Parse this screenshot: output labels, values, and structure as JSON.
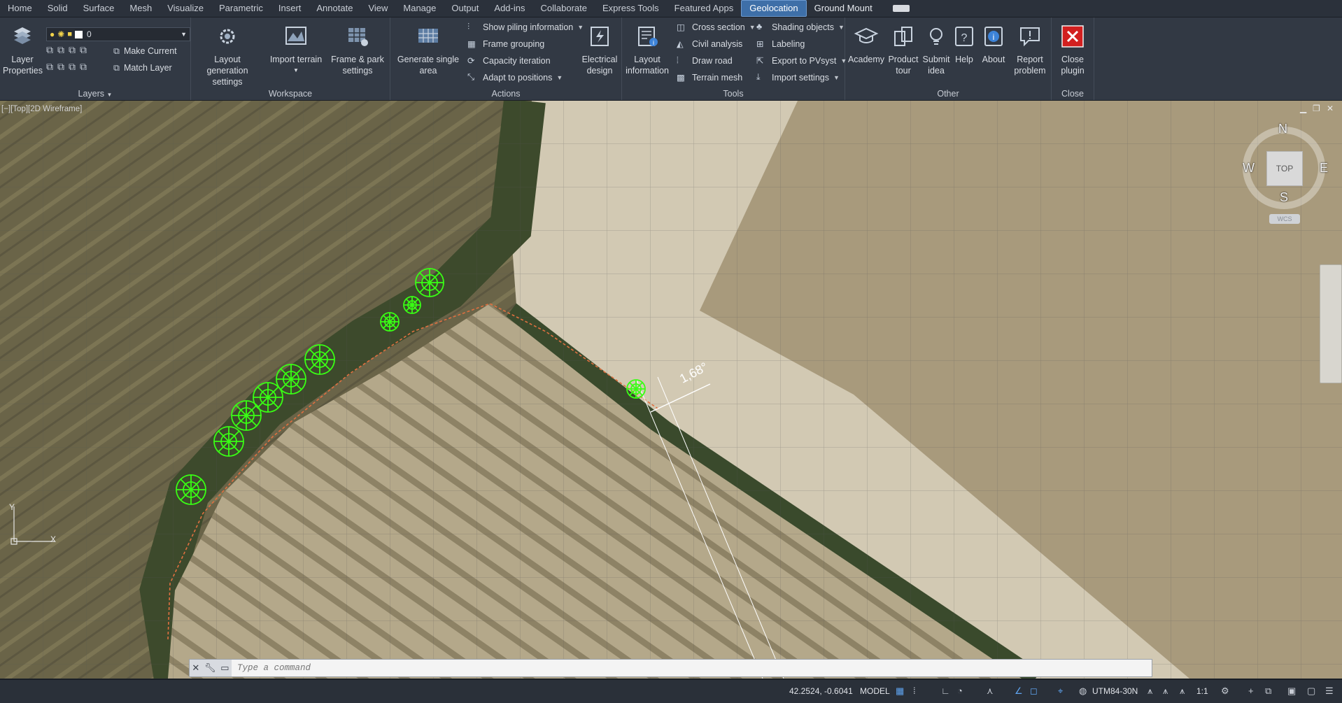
{
  "tabs": [
    {
      "label": "Home"
    },
    {
      "label": "Solid"
    },
    {
      "label": "Surface"
    },
    {
      "label": "Mesh"
    },
    {
      "label": "Visualize"
    },
    {
      "label": "Parametric"
    },
    {
      "label": "Insert"
    },
    {
      "label": "Annotate"
    },
    {
      "label": "View"
    },
    {
      "label": "Manage"
    },
    {
      "label": "Output"
    },
    {
      "label": "Add-ins"
    },
    {
      "label": "Collaborate"
    },
    {
      "label": "Express Tools"
    },
    {
      "label": "Featured Apps"
    },
    {
      "label": "Geolocation"
    },
    {
      "label": "Ground Mount"
    }
  ],
  "active_tab": "Geolocation",
  "ribbon": {
    "layers": {
      "title": "Layers",
      "layer_properties": "Layer\nProperties",
      "layer_value": "0",
      "make_current": "Make Current",
      "match_layer": "Match Layer"
    },
    "workspace": {
      "title": "Workspace",
      "layout_generation": "Layout generation\nsettings",
      "import_terrain": "Import terrain",
      "frame_park": "Frame & park\nsettings"
    },
    "actions": {
      "title": "Actions",
      "generate_single_area": "Generate single\narea",
      "show_piling": "Show piling information",
      "frame_grouping": "Frame grouping",
      "capacity_iteration": "Capacity iteration",
      "adapt_positions": "Adapt to positions",
      "electrical_design": "Electrical\ndesign"
    },
    "tools": {
      "title": "Tools",
      "layout_information": "Layout\ninformation",
      "cross_section": "Cross section",
      "civil_analysis": "Civil analysis",
      "draw_road": "Draw road",
      "terrain_mesh": "Terrain mesh",
      "shading_objects": "Shading objects",
      "labeling": "Labeling",
      "export_pvsyst": "Export to PVsyst",
      "import_settings": "Import settings"
    },
    "other": {
      "title": "Other",
      "academy": "Academy",
      "product_tour": "Product\ntour",
      "submit_idea": "Submit\nidea",
      "help": "Help",
      "about": "About",
      "report_problem": "Report\nproblem"
    },
    "close": {
      "title": "Close",
      "close_plugin": "Close\nplugin"
    }
  },
  "viewport": {
    "label": "[−][Top][2D Wireframe]",
    "angle_label": "1,68°",
    "compass": {
      "n": "N",
      "s": "S",
      "e": "E",
      "w": "W",
      "top": "TOP",
      "wcs": "WCS"
    },
    "axis_x": "X",
    "axis_y": "Y"
  },
  "command_line": {
    "placeholder": "Type a command"
  },
  "status_bar": {
    "coordinates": "42.2524, -0.6041",
    "model": "MODEL",
    "crs": "UTM84-30N",
    "scale": "1:1"
  },
  "colors": {
    "ribbon_bg": "#323944",
    "tabbar_bg": "#2b313b",
    "active_tab": "#3e6fa8",
    "tree_marker": "#39ff14",
    "boundary": "#e07040",
    "close_button": "#d21f1f"
  }
}
